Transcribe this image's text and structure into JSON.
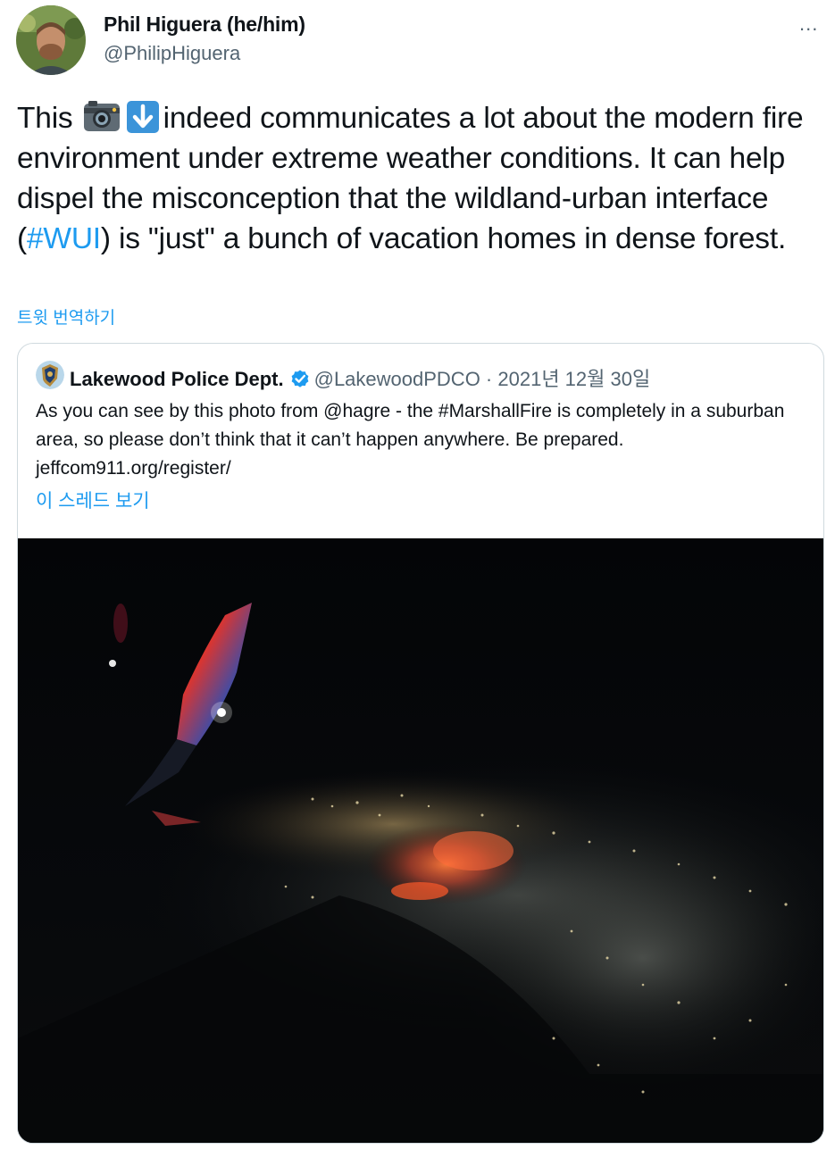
{
  "tweet": {
    "author_name": "Phil Higuera (he/him)",
    "author_handle": "@PhilipHiguera",
    "more_icon": "...",
    "text_before_emoji": "This ",
    "text_after_emoji": "indeed communicates a lot about the modern fire environment under extreme weather conditions. It can help dispel the misconception that the wildland-urban interface (",
    "hashtag": "#WUI",
    "text_after_hashtag": ") is \"just\" a bunch of vacation homes in dense forest.",
    "emojis": [
      "camera-icon",
      "down-arrow-icon"
    ],
    "translate_label": "트윗 번역하기"
  },
  "quoted_tweet": {
    "author_name": "Lakewood Police Dept.",
    "verified": true,
    "author_handle": "@LakewoodPDCO",
    "separator": " · ",
    "date": "2021년 12월 30일",
    "text": "As you can see by this photo from @hagre - the #MarshallFire is completely in a suburban area, so please don’t think that it can’t happen anywhere. Be prepared. jeffcom911.org/register/",
    "show_thread_label": "이 스레드 보기",
    "media": "night aerial photo from airplane window with wing and fire over city lights"
  },
  "colors": {
    "accent": "#1d9bf0",
    "text": "#0f1419",
    "secondary": "#536471",
    "border": "#cfd9de"
  }
}
